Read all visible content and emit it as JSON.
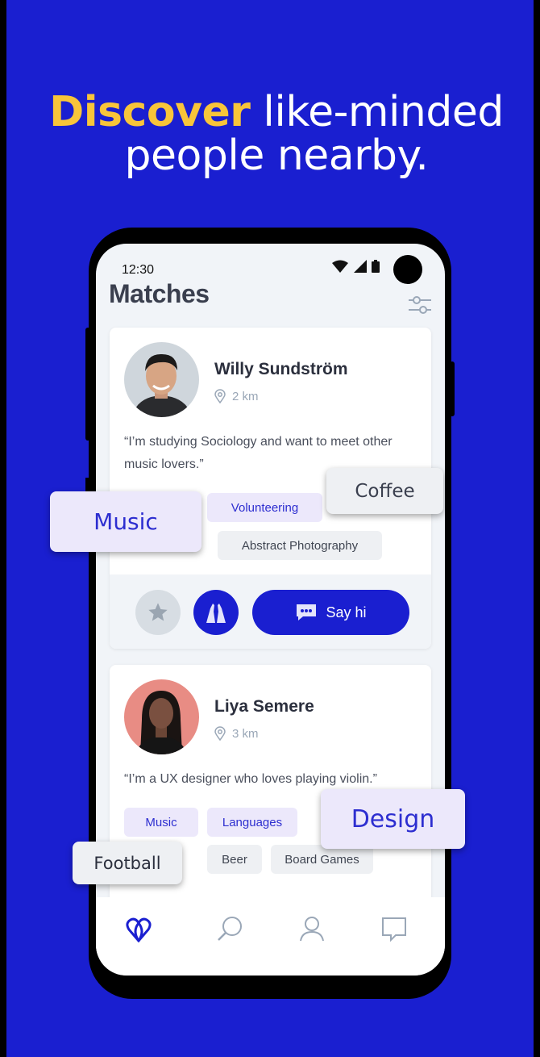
{
  "headline": {
    "highlight": "Discover",
    "rest1": " like-minded",
    "line2": "people nearby."
  },
  "status": {
    "time": "12:30"
  },
  "screen": {
    "title": "Matches"
  },
  "matches": [
    {
      "name": "Willy Sundström",
      "distance": "2 km",
      "bio": "“I’m studying Sociology and want to meet other music lovers.”",
      "tags": [
        "Volunteering",
        "Abstract Photography"
      ],
      "action_label": "Say hi"
    },
    {
      "name": "Liya Semere",
      "distance": "3 km",
      "bio": "“I’m a UX designer who loves playing violin.”",
      "tags": [
        "Music",
        "Languages",
        "Beer",
        "Board Games"
      ]
    }
  ],
  "floating_tags": [
    "Music",
    "Coffee",
    "Design",
    "Football"
  ],
  "colors": {
    "background": "#1a1fd0",
    "accent": "#f8c53a",
    "tag_purple": "#ece8fb"
  },
  "icons": [
    "wifi-icon",
    "signal-icon",
    "battery-icon",
    "filter-icon",
    "location-pin-icon",
    "star-icon",
    "high-five-icon",
    "chat-bubble-icon",
    "matches-tab-icon",
    "search-tab-icon",
    "profile-tab-icon",
    "messages-tab-icon"
  ]
}
